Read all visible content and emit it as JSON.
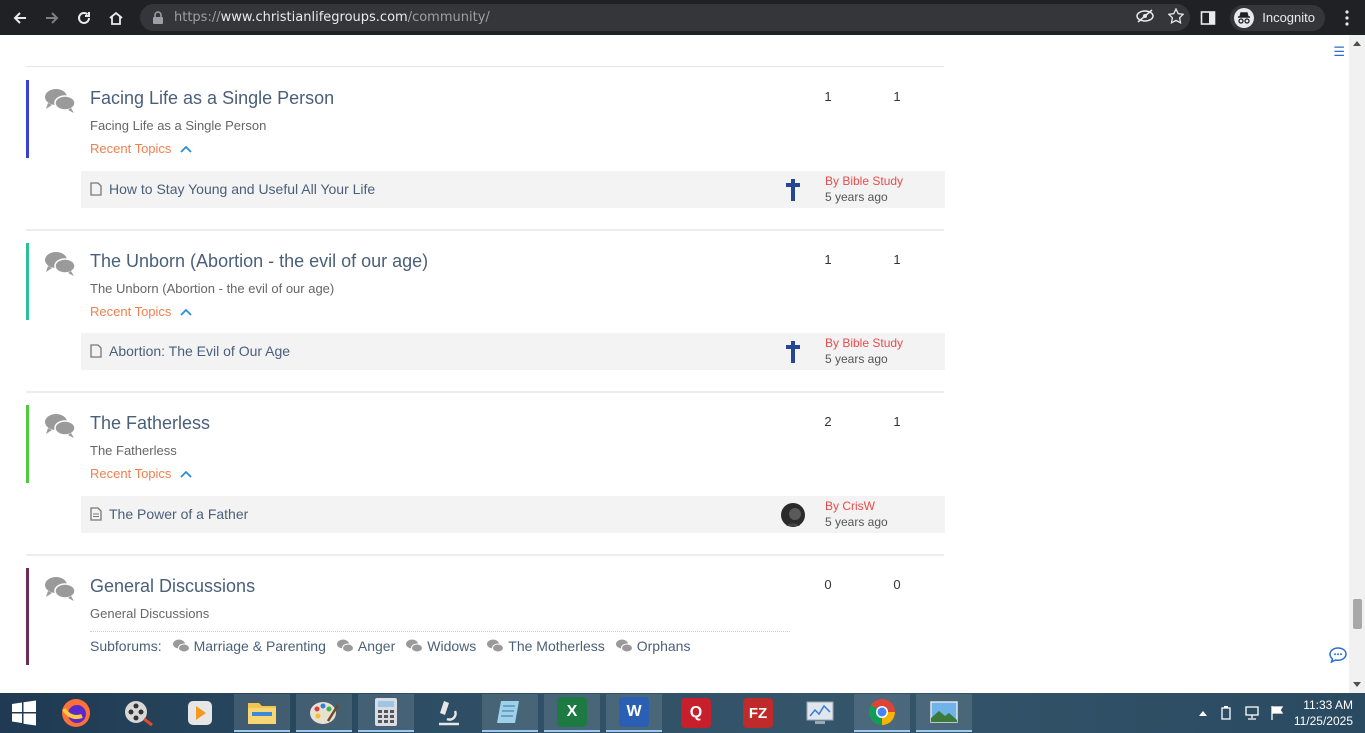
{
  "browser": {
    "url_scheme": "https://",
    "url_host": "www.christianlifegroups.com",
    "url_path": "/community/",
    "incognito_label": "Incognito"
  },
  "forums": [
    {
      "title": "Facing Life as a Single Person",
      "description": "Facing Life as a Single Person",
      "recent_label": "Recent Topics",
      "topics_count": "1",
      "posts_count": "1",
      "accent": "#3a3fd6",
      "topic": {
        "title": "How to Stay Young and Useful All Your Life",
        "by": "By Bible Study",
        "ago": "5 years ago",
        "avatar": "cross-icon"
      }
    },
    {
      "title": "The Unborn (Abortion - the evil of our age)",
      "description": "The Unborn (Abortion - the evil of our age)",
      "recent_label": "Recent Topics",
      "topics_count": "1",
      "posts_count": "1",
      "accent": "#2bbf9c",
      "topic": {
        "title": "Abortion: The Evil of Our Age",
        "by": "By Bible Study",
        "ago": "5 years ago",
        "avatar": "cross-icon"
      }
    },
    {
      "title": "The Fatherless",
      "description": "The Fatherless",
      "recent_label": "Recent Topics",
      "topics_count": "2",
      "posts_count": "1",
      "accent": "#4ccc3a",
      "topic": {
        "title": "The Power of a Father",
        "by": "By CrisW",
        "ago": "5 years ago",
        "avatar": "user-photo"
      }
    },
    {
      "title": "General Discussions",
      "description": "General Discussions",
      "topics_count": "0",
      "posts_count": "0",
      "accent": "#6e2c5a",
      "subforums_label": "Subforums:",
      "subforums": [
        "Marriage & Parenting",
        "Anger",
        "Widows",
        "The Motherless",
        "Orphans"
      ]
    }
  ],
  "taskbar": {
    "apps": [
      "firefox",
      "media-player",
      "vlc",
      "file-explorer",
      "paint",
      "calculator",
      "microscope",
      "notepad",
      "excel",
      "word",
      "qr-app",
      "filezilla",
      "system-monitor",
      "chrome",
      "image-viewer"
    ],
    "time": "11:33 AM",
    "date": "11/25/2025"
  }
}
